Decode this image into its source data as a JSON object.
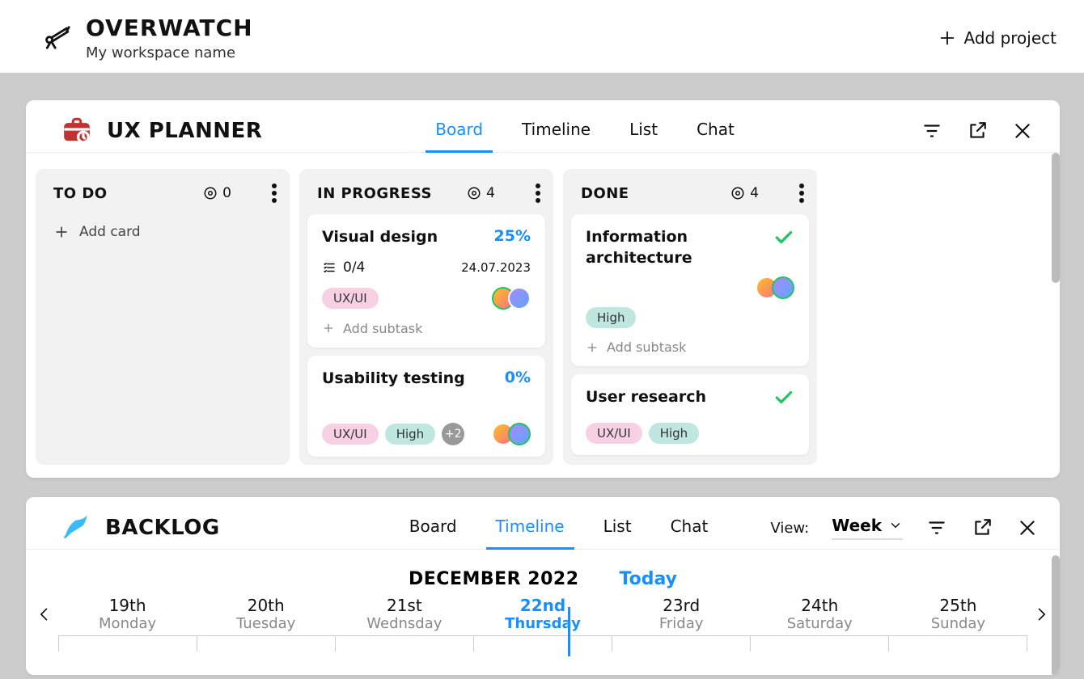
{
  "header": {
    "brand": "OVERWATCH",
    "subtitle": "My workspace name",
    "add_project": "Add project"
  },
  "panel1": {
    "title": "UX PLANNER",
    "tabs": [
      "Board",
      "Timeline",
      "List",
      "Chat"
    ],
    "active_tab_index": 0,
    "columns": [
      {
        "title": "TO DO",
        "count": "0",
        "add_label": "Add card",
        "cards": []
      },
      {
        "title": "IN PROGRESS",
        "count": "4",
        "cards": [
          {
            "title": "Visual design",
            "pct": "25%",
            "sub": "0/4",
            "date": "24.07.2023",
            "pills": [
              "UX/UI"
            ],
            "avatars": 2,
            "add_sub": "Add subtask"
          },
          {
            "title": "Usability testing",
            "pct": "0%",
            "pills": [
              "UX/UI",
              "High",
              "+2"
            ],
            "avatars": 2
          }
        ]
      },
      {
        "title": "DONE",
        "count": "4",
        "cards": [
          {
            "title": "Information architecture",
            "done": true,
            "pills": [
              "High"
            ],
            "avatars": 2,
            "avatar_top": true,
            "add_sub": "Add subtask"
          },
          {
            "title": "User research",
            "done": true,
            "pills": [
              "UX/UI",
              "High"
            ]
          }
        ]
      }
    ]
  },
  "panel2": {
    "title": "BACKLOG",
    "tabs": [
      "Board",
      "Timeline",
      "List",
      "Chat"
    ],
    "active_tab_index": 1,
    "view_label": "View:",
    "view_value": "Week",
    "month": "DECEMBER 2022",
    "today_label": "Today",
    "days": [
      {
        "num": "19th",
        "name": "Monday"
      },
      {
        "num": "20th",
        "name": "Tuesday"
      },
      {
        "num": "21st",
        "name": "Wednsday"
      },
      {
        "num": "22nd",
        "name": "Thursday",
        "active": true
      },
      {
        "num": "23rd",
        "name": "Friday"
      },
      {
        "num": "24th",
        "name": "Saturday"
      },
      {
        "num": "25th",
        "name": "Sunday"
      }
    ]
  }
}
